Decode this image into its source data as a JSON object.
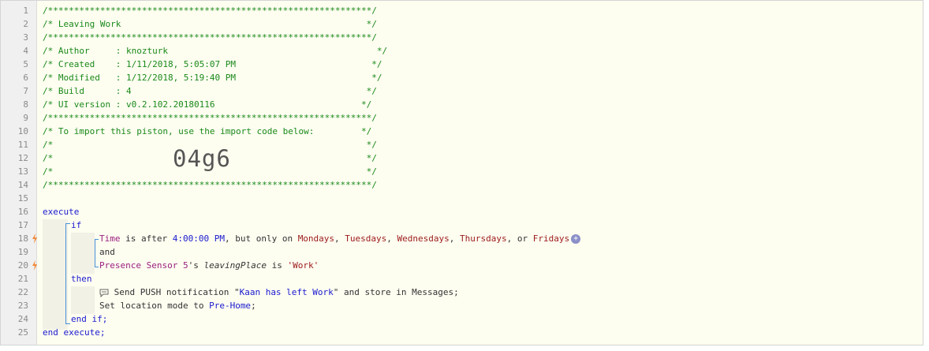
{
  "editor": {
    "line_numbers": [
      "1",
      "2",
      "3",
      "4",
      "5",
      "6",
      "7",
      "8",
      "9",
      "10",
      "11",
      "12",
      "13",
      "14",
      "15",
      "16",
      "17",
      "18",
      "19",
      "20",
      "21",
      "22",
      "23",
      "24",
      "25"
    ],
    "header": {
      "stars": "/**************************************************************/",
      "title": "/* Leaving Work                                               */",
      "author": "/* Author     : knozturk                                        */",
      "created": "/* Created    : 1/11/2018, 5:05:07 PM                          */",
      "modified": "/* Modified   : 1/12/2018, 5:19:40 PM                          */",
      "build": "/* Build      : 4                                             */",
      "ui_version": "/* UI version : v0.2.102.20180116                            */",
      "import_note": "/* To import this piston, use the import code below:         */",
      "blank": "/*                                                            */",
      "import_code": "04g6"
    },
    "code": {
      "execute": "execute",
      "if": "if",
      "time_var": "Time",
      "is_after": " is after ",
      "time_value": "4:00:00 PM",
      "but_only_on": ", but only on ",
      "day1": "Mondays",
      "sep1": ", ",
      "day2": "Tuesdays",
      "sep2": ", ",
      "day3": "Wednesdays",
      "sep3": ", ",
      "day4": "Thursdays",
      "sep4": ", or ",
      "day5": "Fridays",
      "plus_icon": "+",
      "and": "and",
      "device": "Presence Sensor 5",
      "possessive": "'s ",
      "attribute": "leavingPlace",
      "is": " is ",
      "place_value": "'Work'",
      "then": "then",
      "send_push": " Send PUSH notification \"",
      "message": "Kaan has left Work",
      "store_in": "\" and store in Messages;",
      "set_mode": "Set location mode to ",
      "mode_value": "Pre-Home",
      "semicolon": ";",
      "end_if": "end if;",
      "end_execute": "end execute;"
    },
    "colors": {
      "comment": "#1a8a1a",
      "keyword": "#1a1ad0",
      "variable": "#9a2080",
      "value": "#9c1a1a",
      "bracket": "#4a90d9",
      "bolt": "#f08a3a"
    }
  }
}
